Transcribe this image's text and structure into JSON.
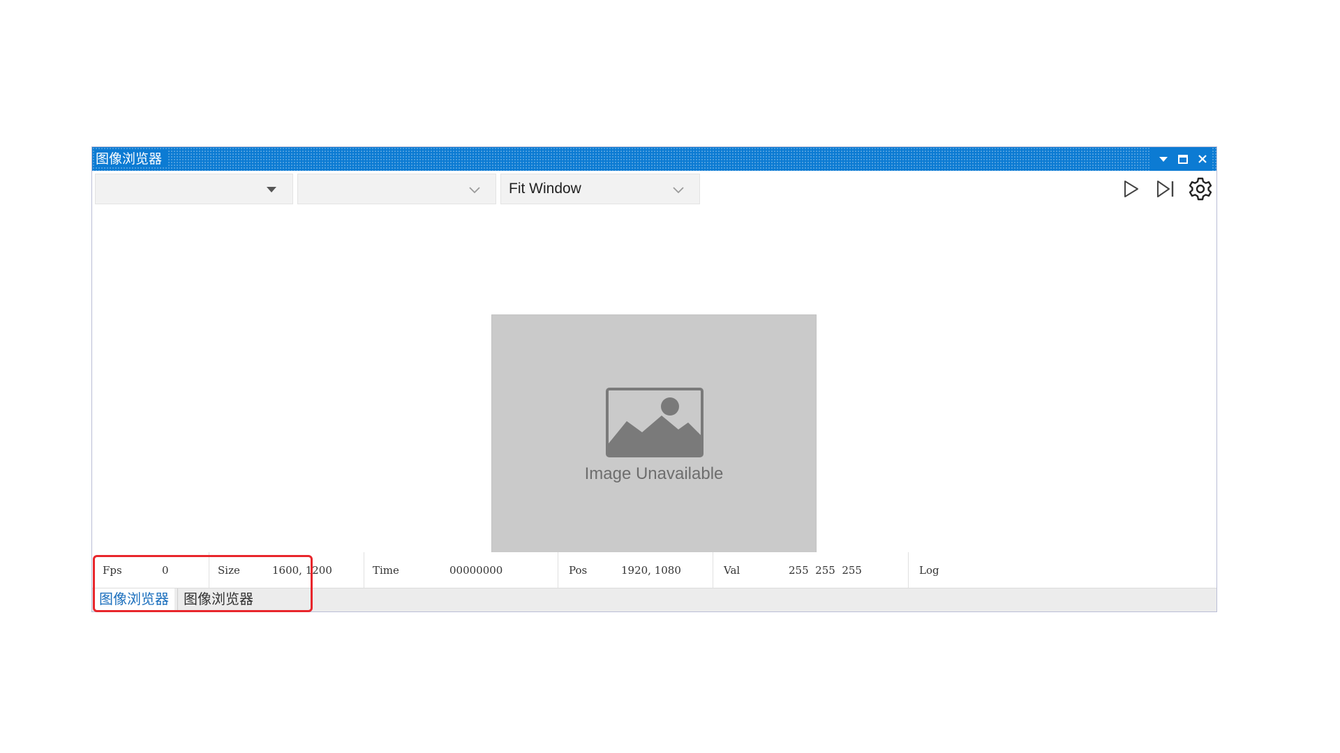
{
  "window": {
    "title": "图像浏览器",
    "accent_color": "#0c7bd3",
    "title_buttons": [
      "dropdown-arrow-icon",
      "maximize-icon",
      "close-icon"
    ]
  },
  "toolbar": {
    "combo1": {
      "value": ""
    },
    "combo2": {
      "value": ""
    },
    "zoom_combo": {
      "value": "Fit Window"
    },
    "tools": [
      "play-icon",
      "step-forward-icon",
      "gear-icon"
    ]
  },
  "viewer": {
    "placeholder_text": "Image Unavailable"
  },
  "status": {
    "fps_label": "Fps",
    "fps_value": "0",
    "size_label": "Size",
    "size_value": "1600, 1200",
    "time_label": "Time",
    "time_value": "00000000",
    "pos_label": "Pos",
    "pos_value": "1920, 1080",
    "val_label": "Val",
    "val_value": "255  255  255",
    "log_label": "Log"
  },
  "tabs": [
    {
      "label": "图像浏览器",
      "active": true
    },
    {
      "label": "图像浏览器",
      "active": false
    }
  ],
  "annotation": {
    "highlight_color": "#e8262c"
  }
}
